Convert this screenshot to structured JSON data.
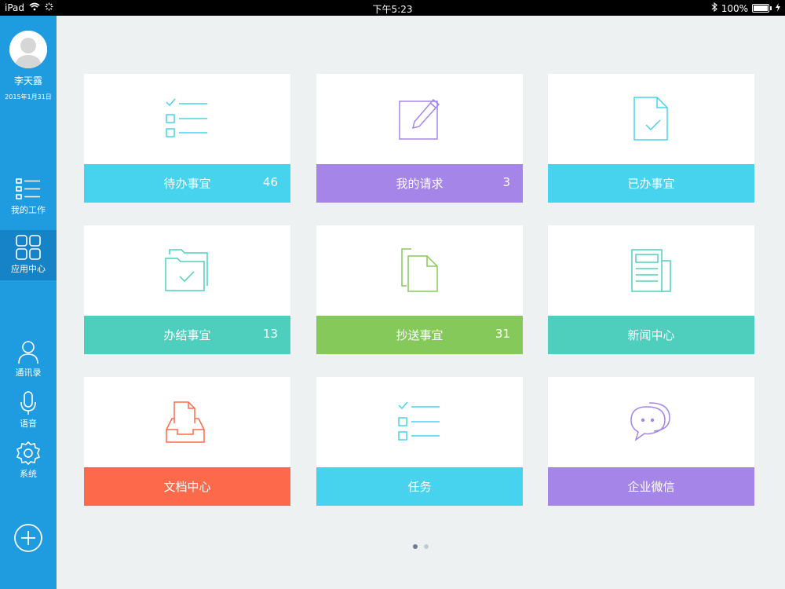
{
  "status_bar": {
    "device": "iPad",
    "time": "下午5:23",
    "battery": "100%"
  },
  "sidebar": {
    "user_name": "李天露",
    "user_date": "2015年1月31日",
    "nav": [
      {
        "label": "我的工作",
        "icon": "list-icon"
      },
      {
        "label": "应用中心",
        "icon": "grid-icon"
      },
      {
        "label": "通讯录",
        "icon": "person-icon"
      },
      {
        "label": "语音",
        "icon": "microphone-icon"
      },
      {
        "label": "系统",
        "icon": "gear-icon"
      }
    ],
    "active_index": 1,
    "add_icon": "plus-circle-icon"
  },
  "tiles": [
    {
      "label": "待办事宜",
      "count": "46",
      "color": "#47d3ed",
      "icon": "checklist-icon"
    },
    {
      "label": "我的请求",
      "count": "3",
      "color": "#a586e8",
      "icon": "edit-icon"
    },
    {
      "label": "已办事宜",
      "count": "",
      "color": "#47d3ed",
      "icon": "document-check-icon"
    },
    {
      "label": "办结事宜",
      "count": "13",
      "color": "#4ecfbd",
      "icon": "folder-check-icon"
    },
    {
      "label": "抄送事宜",
      "count": "31",
      "color": "#85c95a",
      "icon": "copy-icon"
    },
    {
      "label": "新闻中心",
      "count": "",
      "color": "#4ecfbd",
      "icon": "newspaper-icon"
    },
    {
      "label": "文档中心",
      "count": "",
      "color": "#fd6a4b",
      "icon": "inbox-document-icon"
    },
    {
      "label": "任务",
      "count": "",
      "color": "#47d3ed",
      "icon": "checklist-icon"
    },
    {
      "label": "企业微信",
      "count": "",
      "color": "#a586e8",
      "icon": "chat-bubble-icon"
    }
  ],
  "pagination": {
    "pages": 2,
    "current": 1
  }
}
